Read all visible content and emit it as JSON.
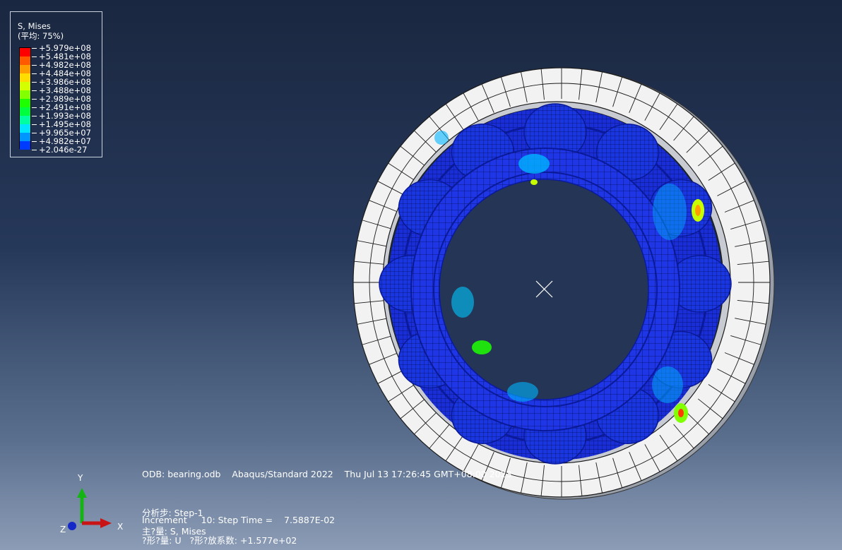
{
  "legend": {
    "title": "S, Mises",
    "subtitle": "(平均: 75%)",
    "levels": [
      {
        "label": "+5.979e+08",
        "color": "#ff0000"
      },
      {
        "label": "+5.481e+08",
        "color": "#ff5a00"
      },
      {
        "label": "+4.982e+08",
        "color": "#ff9e00"
      },
      {
        "label": "+4.484e+08",
        "color": "#ffdd00"
      },
      {
        "label": "+3.986e+08",
        "color": "#d4ff00"
      },
      {
        "label": "+3.488e+08",
        "color": "#82ff00"
      },
      {
        "label": "+2.989e+08",
        "color": "#1eff00"
      },
      {
        "label": "+2.491e+08",
        "color": "#00ff3c"
      },
      {
        "label": "+1.993e+08",
        "color": "#00ffa0"
      },
      {
        "label": "+1.495e+08",
        "color": "#00e6ff"
      },
      {
        "label": "+9.965e+07",
        "color": "#0096ff"
      },
      {
        "label": "+4.982e+07",
        "color": "#003cff"
      },
      {
        "label": "+2.046e-27",
        "color": "#0000ff"
      }
    ]
  },
  "info": {
    "odb_line": "ODB: bearing.odb    Abaqus/Standard 2022    Thu Jul 13 17:26:45 GMT+08:00 2023",
    "step_line": "分析步: Step-1",
    "increment_line": "Increment     10: Step Time =    7.5887E-02",
    "primary_line": "主?量: S, Mises",
    "deformed_line": "?形?量: U   ?形?放系数: +1.577e+02"
  },
  "triad": {
    "x_label": "X",
    "y_label": "Y",
    "z_label": "Z",
    "x_color": "#c81414",
    "y_color": "#14b414",
    "z_color": "#1428c8"
  },
  "colors": {
    "outer_ring": "#f2f2f2",
    "mesh_dark": "#1b1b1b",
    "model_base": "#1a2ed8",
    "model_dark": "#0a1a9a"
  }
}
